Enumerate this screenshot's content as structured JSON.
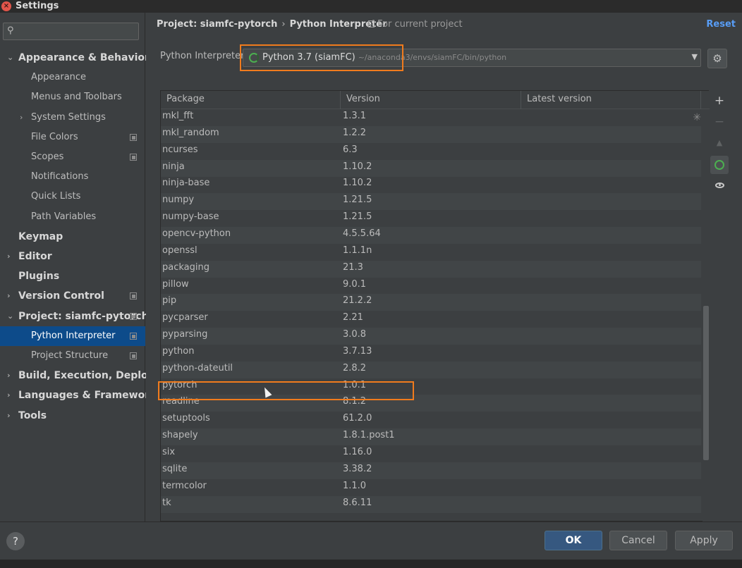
{
  "window": {
    "title": "Settings",
    "close_icon": "×"
  },
  "sidebar": {
    "search_placeholder": "",
    "items": [
      {
        "label": "Appearance & Behavior",
        "level": 0,
        "arrow": "⌄"
      },
      {
        "label": "Appearance",
        "level": 1
      },
      {
        "label": "Menus and Toolbars",
        "level": 1
      },
      {
        "label": "System Settings",
        "level": 1,
        "arrow": "›"
      },
      {
        "label": "File Colors",
        "level": 1,
        "copy": true
      },
      {
        "label": "Scopes",
        "level": 1,
        "copy": true
      },
      {
        "label": "Notifications",
        "level": 1
      },
      {
        "label": "Quick Lists",
        "level": 1
      },
      {
        "label": "Path Variables",
        "level": 1
      },
      {
        "label": "Keymap",
        "level": 0
      },
      {
        "label": "Editor",
        "level": 0,
        "arrow": "›"
      },
      {
        "label": "Plugins",
        "level": 0
      },
      {
        "label": "Version Control",
        "level": 0,
        "arrow": "›",
        "copy": true
      },
      {
        "label": "Project: siamfc-pytorch",
        "level": 0,
        "arrow": "⌄",
        "copy": true
      },
      {
        "label": "Python Interpreter",
        "level": 1,
        "copy": true,
        "selected": true
      },
      {
        "label": "Project Structure",
        "level": 1,
        "copy": true
      },
      {
        "label": "Build, Execution, Deployment",
        "level": 0,
        "arrow": "›"
      },
      {
        "label": "Languages & Frameworks",
        "level": 0,
        "arrow": "›"
      },
      {
        "label": "Tools",
        "level": 0,
        "arrow": "›"
      }
    ]
  },
  "header": {
    "breadcrumb_project": "Project: siamfc-pytorch",
    "breadcrumb_sep": "›",
    "breadcrumb_page": "Python Interpreter",
    "for_current": "For current project",
    "reset": "Reset"
  },
  "interpreter": {
    "label": "Python Interpreter:",
    "name": "Python 3.7 (siamFC)",
    "path": "~/anaconda3/envs/siamFC/bin/python",
    "gear_icon": "⚙"
  },
  "table": {
    "columns": [
      "Package",
      "Version",
      "Latest version"
    ],
    "rows": [
      [
        "mkl_fft",
        "1.3.1"
      ],
      [
        "mkl_random",
        "1.2.2"
      ],
      [
        "ncurses",
        "6.3"
      ],
      [
        "ninja",
        "1.10.2"
      ],
      [
        "ninja-base",
        "1.10.2"
      ],
      [
        "numpy",
        "1.21.5"
      ],
      [
        "numpy-base",
        "1.21.5"
      ],
      [
        "opencv-python",
        "4.5.5.64"
      ],
      [
        "openssl",
        "1.1.1n"
      ],
      [
        "packaging",
        "21.3"
      ],
      [
        "pillow",
        "9.0.1"
      ],
      [
        "pip",
        "21.2.2"
      ],
      [
        "pycparser",
        "2.21"
      ],
      [
        "pyparsing",
        "3.0.8"
      ],
      [
        "python",
        "3.7.13"
      ],
      [
        "python-dateutil",
        "2.8.2"
      ],
      [
        "pytorch",
        "1.0.1"
      ],
      [
        "readline",
        "8.1.2"
      ],
      [
        "setuptools",
        "61.2.0"
      ],
      [
        "shapely",
        "1.8.1.post1"
      ],
      [
        "six",
        "1.16.0"
      ],
      [
        "sqlite",
        "3.38.2"
      ],
      [
        "termcolor",
        "1.1.0"
      ],
      [
        "tk",
        "8.6.11"
      ]
    ]
  },
  "toolbar": {
    "add": "+",
    "remove": "−",
    "upgrade": "▲"
  },
  "footer": {
    "help": "?",
    "ok": "OK",
    "cancel": "Cancel",
    "apply": "Apply"
  }
}
